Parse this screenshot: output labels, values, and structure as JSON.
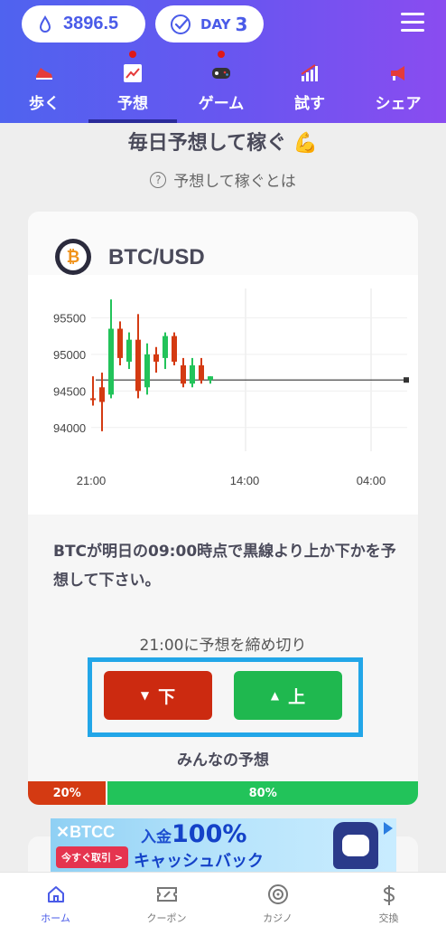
{
  "header": {
    "points": "3896.5",
    "day_label": "DAY",
    "day_num": "3",
    "nav": [
      {
        "label": "歩く",
        "icon": "sneaker-icon",
        "dot": false,
        "active": false
      },
      {
        "label": "予想",
        "icon": "chart-icon",
        "dot": true,
        "active": true
      },
      {
        "label": "ゲーム",
        "icon": "gamepad-icon",
        "dot": true,
        "active": false
      },
      {
        "label": "試す",
        "icon": "bar-growth-icon",
        "dot": false,
        "active": false
      },
      {
        "label": "シェア",
        "icon": "megaphone-icon",
        "dot": false,
        "active": false
      }
    ]
  },
  "main": {
    "title": "毎日予想して稼ぐ 💪",
    "howto": "予想して稼ぐとは"
  },
  "card": {
    "pair": "BTC/USD",
    "question": "BTCが明日の09:00時点で黒線より上か下かを予想して下さい。",
    "deadline": "21:00に予想を締め切り",
    "down_label": "下",
    "up_label": "上",
    "everyone_label": "みんなの予想",
    "down_pct": "20%",
    "up_pct": "80%"
  },
  "chart_data": {
    "type": "candlestick",
    "y_ticks": [
      "95500",
      "95000",
      "94500",
      "94000"
    ],
    "x_ticks": [
      "21:00",
      "14:00",
      "04:00"
    ],
    "ylim": [
      93800,
      95900
    ],
    "reference_line": 94650,
    "candles": [
      {
        "o": 94400,
        "h": 94700,
        "l": 94300,
        "c": 94400,
        "color": "red"
      },
      {
        "o": 94550,
        "h": 94750,
        "l": 93950,
        "c": 94350,
        "color": "red"
      },
      {
        "o": 94450,
        "h": 95750,
        "l": 94400,
        "c": 95350,
        "color": "green"
      },
      {
        "o": 95350,
        "h": 95450,
        "l": 94850,
        "c": 94950,
        "color": "red"
      },
      {
        "o": 94900,
        "h": 95300,
        "l": 94800,
        "c": 95200,
        "color": "green"
      },
      {
        "o": 95200,
        "h": 95550,
        "l": 94400,
        "c": 94500,
        "color": "red"
      },
      {
        "o": 94550,
        "h": 95150,
        "l": 94450,
        "c": 95000,
        "color": "green"
      },
      {
        "o": 95000,
        "h": 95100,
        "l": 94750,
        "c": 94900,
        "color": "red"
      },
      {
        "o": 94950,
        "h": 95300,
        "l": 94800,
        "c": 95250,
        "color": "green"
      },
      {
        "o": 95250,
        "h": 95300,
        "l": 94850,
        "c": 94900,
        "color": "red"
      },
      {
        "o": 94850,
        "h": 94950,
        "l": 94550,
        "c": 94600,
        "color": "red"
      },
      {
        "o": 94600,
        "h": 94950,
        "l": 94550,
        "c": 94850,
        "color": "green"
      },
      {
        "o": 94850,
        "h": 94950,
        "l": 94600,
        "c": 94650,
        "color": "red"
      },
      {
        "o": 94650,
        "h": 94700,
        "l": 94600,
        "c": 94700,
        "color": "green"
      }
    ],
    "colors": {
      "up": "#22c35a",
      "down": "#d43a12",
      "line": "#333333"
    }
  },
  "ad": {
    "brand": "✕BTCC",
    "cta": "今すぐ取引 >",
    "headline_pre": "入金",
    "headline_big": "100%",
    "sub": "キャッシュバック"
  },
  "bottom_nav": [
    {
      "label": "ホーム",
      "icon": "home-icon",
      "active": true
    },
    {
      "label": "クーポン",
      "icon": "coupon-icon",
      "active": false
    },
    {
      "label": "カジノ",
      "icon": "casino-chip-icon",
      "active": false
    },
    {
      "label": "交換",
      "icon": "dollar-icon",
      "active": false
    }
  ],
  "colors": {
    "accent": "#4a5be8",
    "down": "#cc2a10",
    "up": "#1fb84f",
    "highlight_frame": "#22a6e8"
  }
}
